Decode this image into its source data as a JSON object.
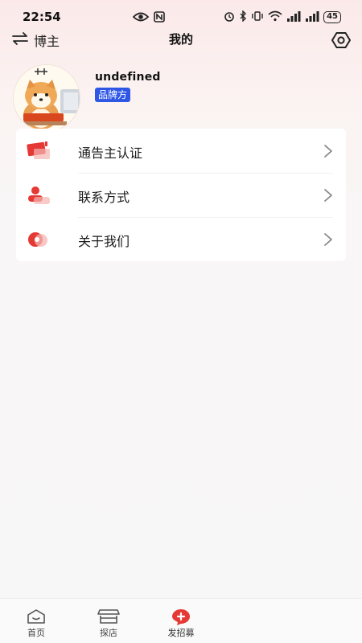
{
  "status_bar": {
    "time": "22:54",
    "battery": "45"
  },
  "header": {
    "switch_label": "博主",
    "title": "我的"
  },
  "profile": {
    "username": "undefined",
    "role_badge": "品牌方"
  },
  "menu": {
    "items": [
      {
        "label": "通告主认证",
        "icon": "certification-icon"
      },
      {
        "label": "联系方式",
        "icon": "contact-icon"
      },
      {
        "label": "关于我们",
        "icon": "about-icon"
      }
    ]
  },
  "bottom_nav": {
    "items": [
      {
        "label": "首页",
        "icon": "home-icon"
      },
      {
        "label": "探店",
        "icon": "store-icon"
      },
      {
        "label": "发招募",
        "icon": "add-recruit-icon"
      }
    ]
  },
  "colors": {
    "accent_red": "#e53935",
    "badge_blue": "#2f57e6"
  }
}
